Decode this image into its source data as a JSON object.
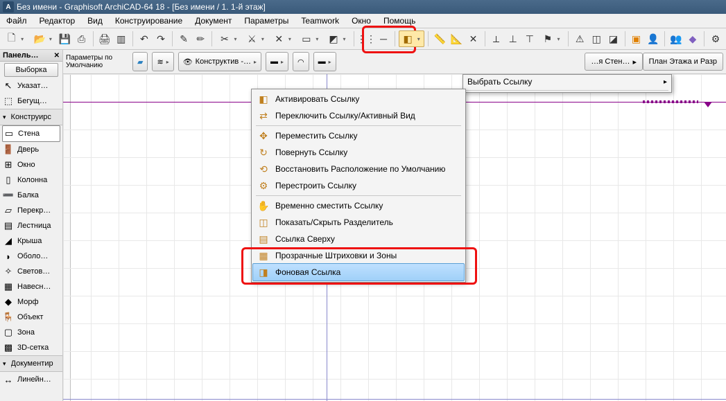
{
  "title": "Без имени - Graphisoft ArchiCAD-64 18 - [Без имени / 1. 1-й этаж]",
  "menubar": [
    "Файл",
    "Редактор",
    "Вид",
    "Конструирование",
    "Документ",
    "Параметры",
    "Teamwork",
    "Окно",
    "Помощь"
  ],
  "toolbox": {
    "header": "Панель…",
    "selector": "Выборка",
    "rows": [
      {
        "type": "item",
        "icon": "cursor",
        "label": "Указат…"
      },
      {
        "type": "item",
        "icon": "marquee",
        "label": "Бегущ…"
      },
      {
        "type": "header",
        "label": "Конструирс"
      },
      {
        "type": "item",
        "icon": "wall",
        "label": "Стена",
        "selected": true
      },
      {
        "type": "item",
        "icon": "door",
        "label": "Дверь"
      },
      {
        "type": "item",
        "icon": "window",
        "label": "Окно"
      },
      {
        "type": "item",
        "icon": "column",
        "label": "Колонна"
      },
      {
        "type": "item",
        "icon": "beam",
        "label": "Балка"
      },
      {
        "type": "item",
        "icon": "slab",
        "label": "Перекр…"
      },
      {
        "type": "item",
        "icon": "stair",
        "label": "Лестница"
      },
      {
        "type": "item",
        "icon": "roof",
        "label": "Крыша"
      },
      {
        "type": "item",
        "icon": "shell",
        "label": "Оболо…"
      },
      {
        "type": "item",
        "icon": "skylight",
        "label": "Светов…"
      },
      {
        "type": "item",
        "icon": "curtain",
        "label": "Навесн…"
      },
      {
        "type": "item",
        "icon": "morph",
        "label": "Морф"
      },
      {
        "type": "item",
        "icon": "object",
        "label": "Объект"
      },
      {
        "type": "item",
        "icon": "zone",
        "label": "Зона"
      },
      {
        "type": "item",
        "icon": "mesh",
        "label": "3D-сетка"
      },
      {
        "type": "header",
        "label": "Документир"
      },
      {
        "type": "item",
        "icon": "dim",
        "label": "Линейн…"
      }
    ]
  },
  "infobar": {
    "defaults_label": "Параметры по\nУмолчанию",
    "view_btn": "Конструктив -…",
    "tab_right1": "…я Стен…",
    "tab_right2": "План Этажа и Разр"
  },
  "dropdown_parent": {
    "label": "Выбрать Ссылку"
  },
  "dropdown_items": [
    {
      "icon": "activate",
      "label": "Активировать Ссылку"
    },
    {
      "icon": "toggle",
      "label": "Переключить Ссылку/Активный Вид"
    },
    {
      "sep": true
    },
    {
      "icon": "move",
      "label": "Переместить Ссылку"
    },
    {
      "icon": "rotate",
      "label": "Повернуть Ссылку"
    },
    {
      "icon": "restore",
      "label": "Восстановить Расположение по Умолчанию"
    },
    {
      "icon": "rebuild",
      "label": "Перестроить Ссылку"
    },
    {
      "sep": true
    },
    {
      "icon": "temp",
      "label": "Временно сместить Ссылку"
    },
    {
      "icon": "split",
      "label": "Показать/Скрыть Разделитель"
    },
    {
      "icon": "top",
      "label": "Ссылка Сверху"
    },
    {
      "icon": "transp",
      "label": "Прозрачные Штриховки и Зоны"
    },
    {
      "icon": "bg",
      "label": "Фоновая Ссылка",
      "highlighted": true
    }
  ],
  "colors": {
    "accent": "#316ac5",
    "highlight_border": "#e11",
    "menu_hover": "#d6e5f3",
    "purple": "#880088"
  }
}
